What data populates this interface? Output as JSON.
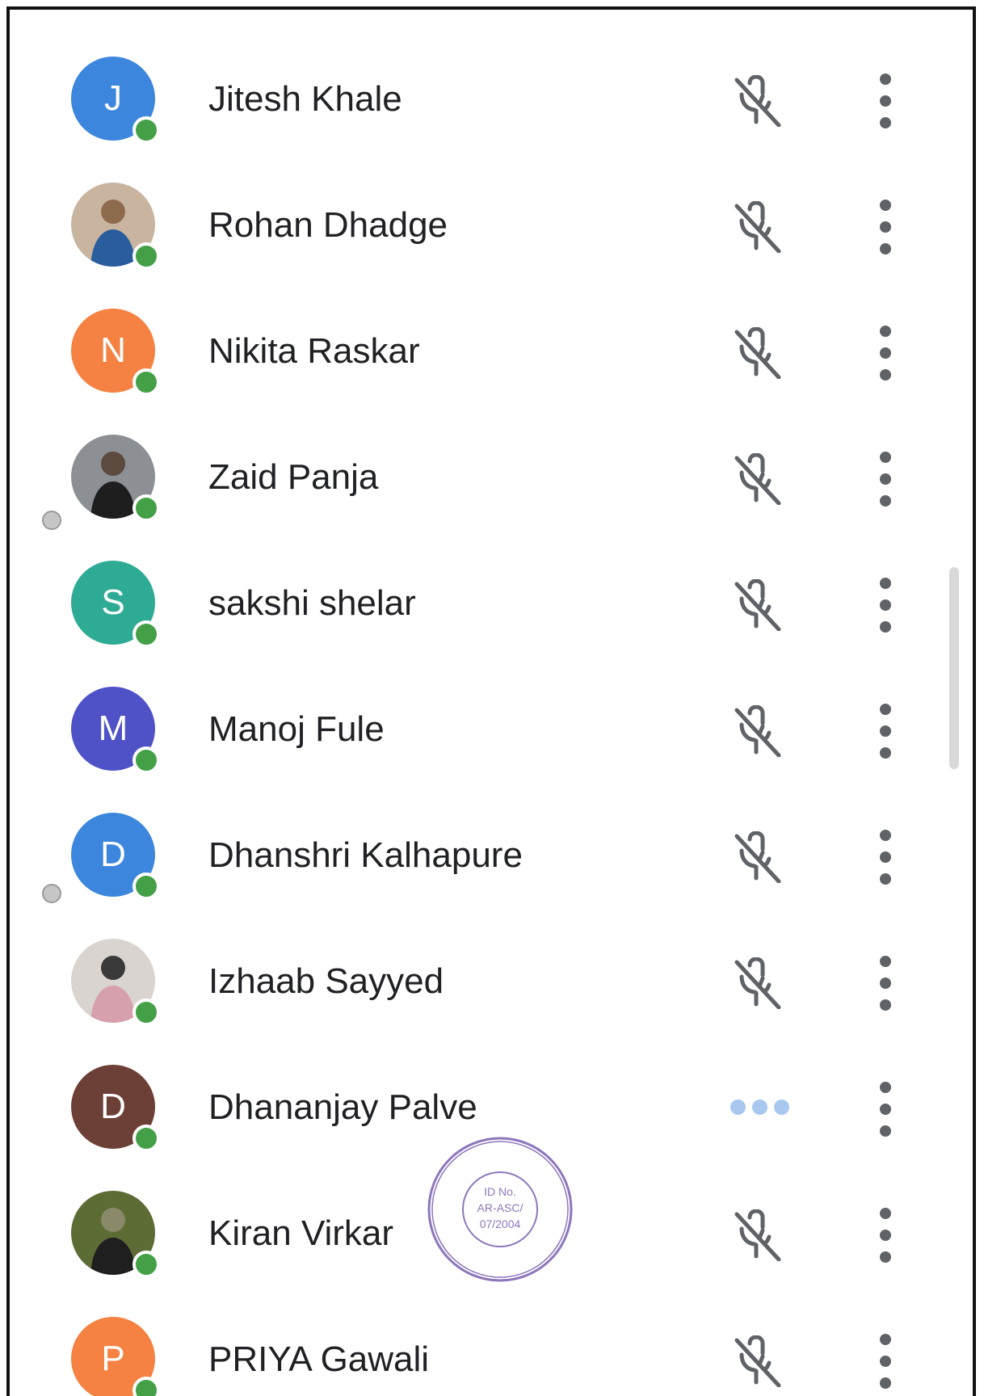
{
  "participants": [
    {
      "name": "Jitesh Khale",
      "avatar_type": "letter",
      "initial": "J",
      "color": "#3c86dd",
      "online": true,
      "status_icon": "mic-off-icon"
    },
    {
      "name": "Rohan Dhadge",
      "avatar_type": "photo",
      "photo_palette": [
        "#c9b4a0",
        "#2a5d9e",
        "#8f6b4e"
      ],
      "online": true,
      "status_icon": "mic-off-icon"
    },
    {
      "name": "Nikita Raskar",
      "avatar_type": "letter",
      "initial": "N",
      "color": "#f58142",
      "online": true,
      "status_icon": "mic-off-icon"
    },
    {
      "name": "Zaid Panja",
      "avatar_type": "photo",
      "photo_palette": [
        "#8c8f93",
        "#1e1e1e",
        "#5b4a3d"
      ],
      "online": true,
      "status_icon": "mic-off-icon"
    },
    {
      "name": "sakshi shelar",
      "avatar_type": "letter",
      "initial": "S",
      "color": "#2eab94",
      "online": true,
      "status_icon": "mic-off-icon"
    },
    {
      "name": "Manoj Fule",
      "avatar_type": "letter",
      "initial": "M",
      "color": "#4f51c7",
      "online": true,
      "status_icon": "mic-off-icon"
    },
    {
      "name": "Dhanshri Kalhapure",
      "avatar_type": "letter",
      "initial": "D",
      "color": "#3c86dd",
      "online": true,
      "status_icon": "mic-off-icon"
    },
    {
      "name": "Izhaab Sayyed",
      "avatar_type": "photo",
      "photo_palette": [
        "#d9d4cf",
        "#d7a0ad",
        "#3a3a3a"
      ],
      "online": true,
      "status_icon": "mic-off-icon"
    },
    {
      "name": "Dhananjay Palve",
      "avatar_type": "letter",
      "initial": "D",
      "color": "#6d4037",
      "online": true,
      "status_icon": "typing-dots-icon"
    },
    {
      "name": "Kiran Virkar",
      "avatar_type": "photo",
      "photo_palette": [
        "#5d6b35",
        "#1f1f1f",
        "#8a8a6a"
      ],
      "online": true,
      "status_icon": "mic-off-icon"
    },
    {
      "name": "PRIYA Gawali",
      "avatar_type": "letter",
      "initial": "P",
      "color": "#f58142",
      "online": true,
      "status_icon": "mic-off-icon"
    }
  ],
  "colors": {
    "online_indicator": "#43a047",
    "icon_gray": "#5f6368",
    "typing_dots": "#a9c8ef",
    "stamp_ink": "#7a5fb0"
  },
  "stamp": {
    "lines": [
      "ID No.",
      "AR-ASC/",
      "07/2004"
    ]
  }
}
